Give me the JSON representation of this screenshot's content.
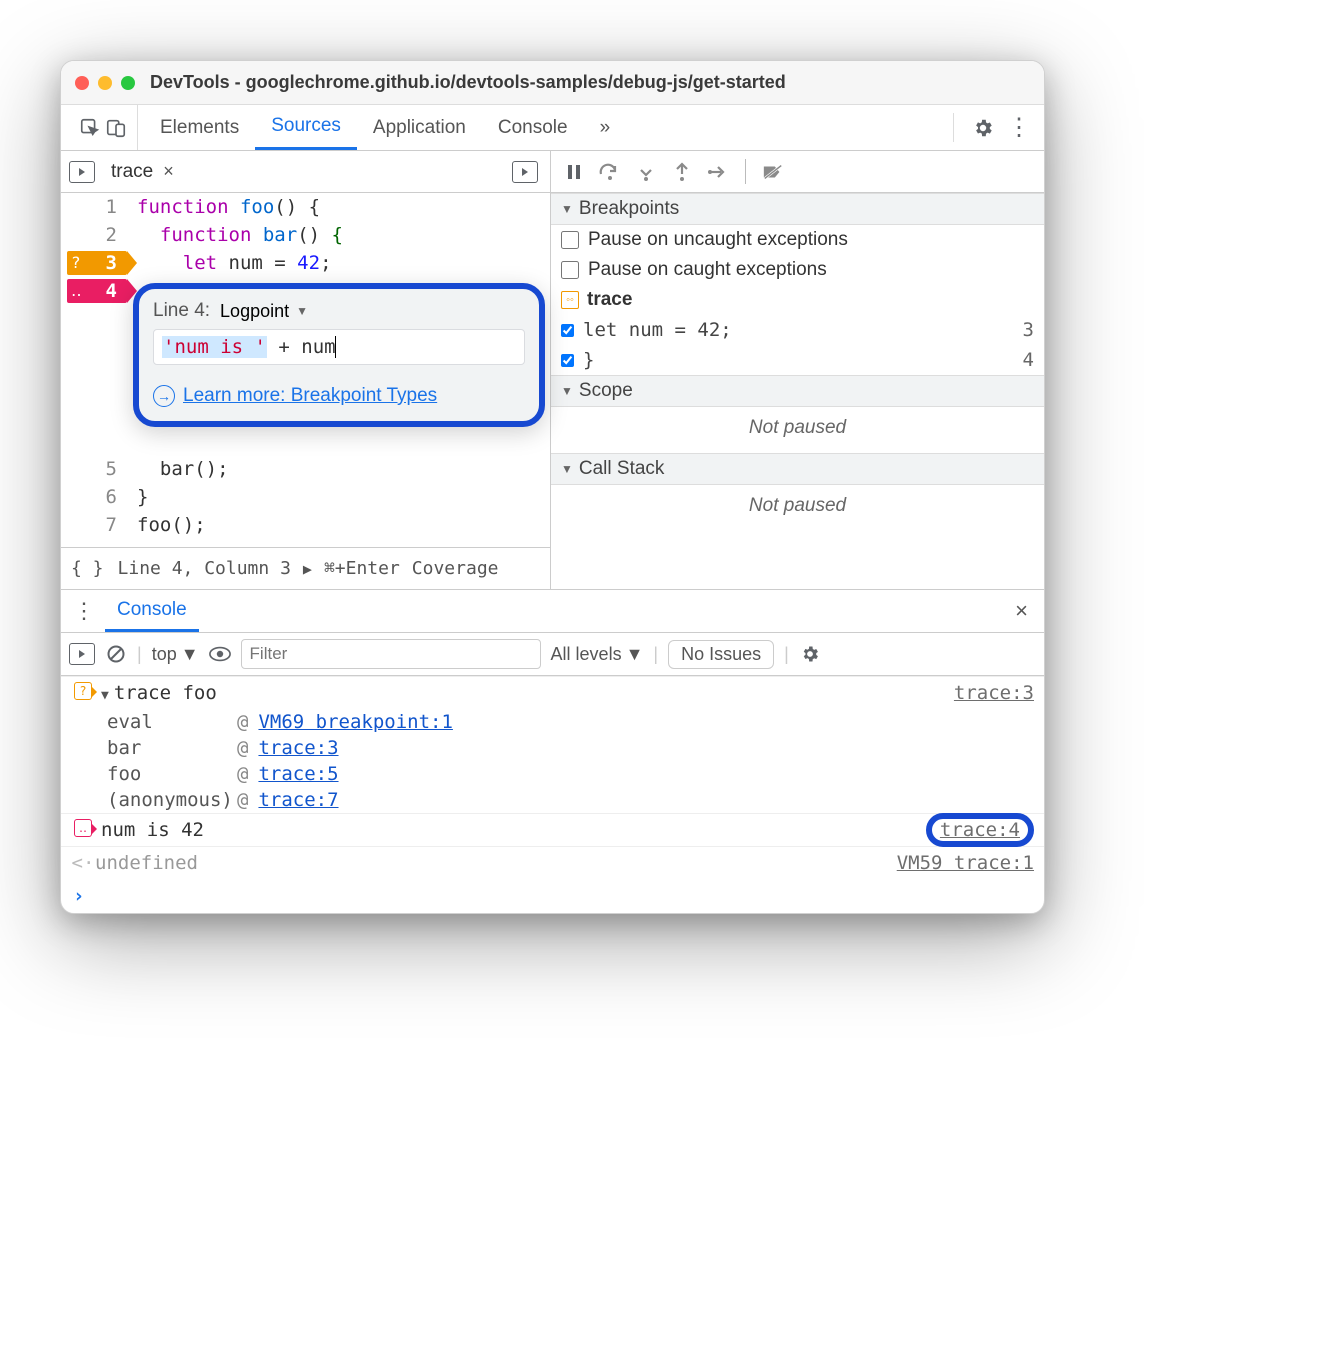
{
  "window": {
    "title": "DevTools - googlechrome.github.io/devtools-samples/debug-js/get-started"
  },
  "tabs": {
    "elements": "Elements",
    "sources": "Sources",
    "application": "Application",
    "console": "Console",
    "more": "»"
  },
  "file": {
    "name": "trace"
  },
  "code": {
    "l1": "function foo() {",
    "l2": "  function bar() {",
    "l3": "    let num = 42;",
    "l4": "  }",
    "l5": "  bar();",
    "l6": "}",
    "l7": "foo();",
    "n1": "1",
    "n2": "2",
    "n3": "3",
    "n4": "4",
    "n5": "5",
    "n6": "6",
    "n7": "7",
    "badge3_pre": "?",
    "badge4_pre": "‥"
  },
  "popover": {
    "line_label": "Line 4:",
    "type": "Logpoint",
    "expr_str": "'num is '",
    "expr_rest": " + num",
    "learn": "Learn more: Breakpoint Types"
  },
  "footer": {
    "pretty": "{ }",
    "pos": "Line 4, Column 3",
    "shortcut": "⌘+Enter",
    "coverage": "Coverage"
  },
  "side": {
    "breakpoints": "Breakpoints",
    "uncaught": "Pause on uncaught exceptions",
    "caught": "Pause on caught exceptions",
    "file": "trace",
    "bp1": "let num = 42;",
    "bp1_n": "3",
    "bp2": "}",
    "bp2_n": "4",
    "scope": "Scope",
    "callstack": "Call Stack",
    "notpaused": "Not paused"
  },
  "drawer": {
    "console": "Console"
  },
  "cctrl": {
    "top": "top",
    "filter_ph": "Filter",
    "levels": "All levels",
    "noissues": "No Issues"
  },
  "console": {
    "trace_label": "trace foo",
    "trace_src": "trace:3",
    "s1_fn": "eval",
    "s1_at": "@",
    "s1_loc": "VM69 breakpoint:1",
    "s2_fn": "bar",
    "s2_at": "@",
    "s2_loc": "trace:3",
    "s3_fn": "foo",
    "s3_at": "@",
    "s3_loc": "trace:5",
    "s4_fn": "(anonymous)",
    "s4_at": "@",
    "s4_loc": "trace:7",
    "log_msg": "num is 42",
    "log_src": "trace:4",
    "undef": "undefined",
    "undef_src": "VM59 trace:1"
  }
}
